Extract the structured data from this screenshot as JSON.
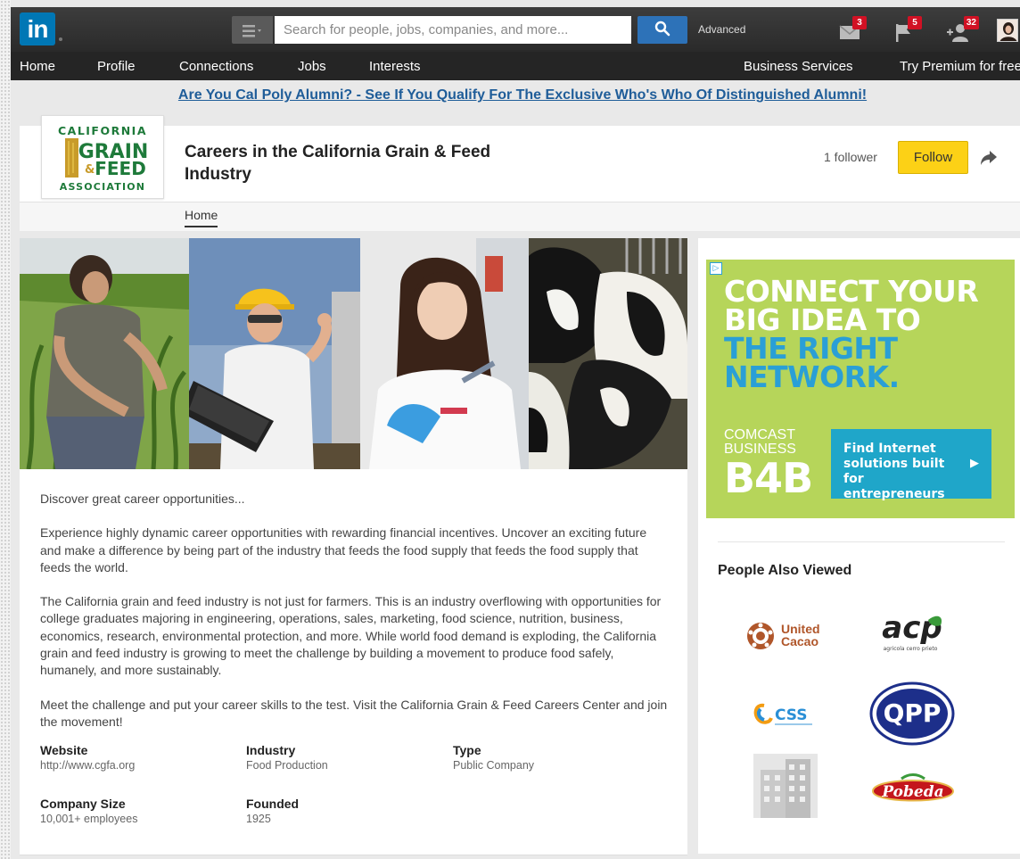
{
  "topbar": {
    "logo_text": "in",
    "search_placeholder": "Search for people, jobs, companies, and more...",
    "advanced_label": "Advanced",
    "notifications": [
      {
        "icon": "envelope-icon",
        "count": "3"
      },
      {
        "icon": "flag-icon",
        "count": "5"
      },
      {
        "icon": "add-connection-icon",
        "count": "32"
      }
    ]
  },
  "nav": {
    "items": [
      "Home",
      "Profile",
      "Connections",
      "Jobs",
      "Interests"
    ],
    "business_services": "Business Services",
    "premium": "Try Premium for free"
  },
  "promo": {
    "text": "Are You Cal Poly Alumni? - See If You Qualify For The Exclusive Who's Who Of Distinguished Alumni!"
  },
  "company": {
    "logo": {
      "line1": "CALIFORNIA",
      "line2": "GRAIN",
      "line3": "FEED",
      "line4": "ASSOCIATION"
    },
    "name": "Careers in the California Grain & Feed Industry",
    "followers": "1 follower",
    "follow_label": "Follow",
    "tabs": [
      "Home"
    ]
  },
  "about": {
    "paragraphs": [
      "Discover great career opportunities...",
      "Experience highly dynamic career opportunities with rewarding financial incentives. Uncover an exciting future and make a difference by being part of the industry that feeds the food supply that feeds the food supply that feeds the world.",
      "The California grain and feed industry is not just for farmers. This is an industry overflowing with opportunities for college graduates majoring in engineering, operations, sales, marketing, food science, nutrition, business, economics, research, environmental protection, and more. While world food demand is exploding, the California grain and feed industry is growing to meet the challenge by building a movement to produce food safely, humanely, and more sustainably.",
      "Meet the challenge and put your career skills to the test. Visit the California Grain & Feed Careers Center and join the movement!"
    ]
  },
  "facts": {
    "website": {
      "label": "Website",
      "value": "http://www.cgfa.org"
    },
    "industry": {
      "label": "Industry",
      "value": "Food Production"
    },
    "type": {
      "label": "Type",
      "value": "Public Company"
    },
    "size": {
      "label": "Company Size",
      "value": "10,001+ employees"
    },
    "founded": {
      "label": "Founded",
      "value": "1925"
    }
  },
  "ad": {
    "headline_1": "CONNECT YOUR",
    "headline_2": "BIG IDEA TO",
    "headline_3": "THE RIGHT",
    "headline_4": "NETWORK.",
    "brand_1": "COMCAST",
    "brand_2": "BUSINESS",
    "brand_3": "B4B",
    "cta": "Find Internet solutions built for entrepreneurs",
    "colors": {
      "background": "#b6d55a",
      "accent": "#2a9fd6",
      "cta": "#1fa6c9"
    }
  },
  "people_also_viewed": {
    "title": "People Also Viewed",
    "companies": [
      {
        "name": "United Cacao",
        "line1": "United",
        "line2": "Cacao"
      },
      {
        "name": "acp",
        "text": "acp",
        "sub": "agricola cerro prieto"
      },
      {
        "name": "CSS",
        "text": "CSS"
      },
      {
        "name": "QPP",
        "text": "QPP"
      },
      {
        "name": "placeholder-building"
      },
      {
        "name": "Pobeda",
        "text": "Pobeda"
      }
    ]
  },
  "colors": {
    "linkedin_blue": "#0077b5",
    "follow_yellow": "#fcd116",
    "link_blue": "#1f5d99"
  }
}
